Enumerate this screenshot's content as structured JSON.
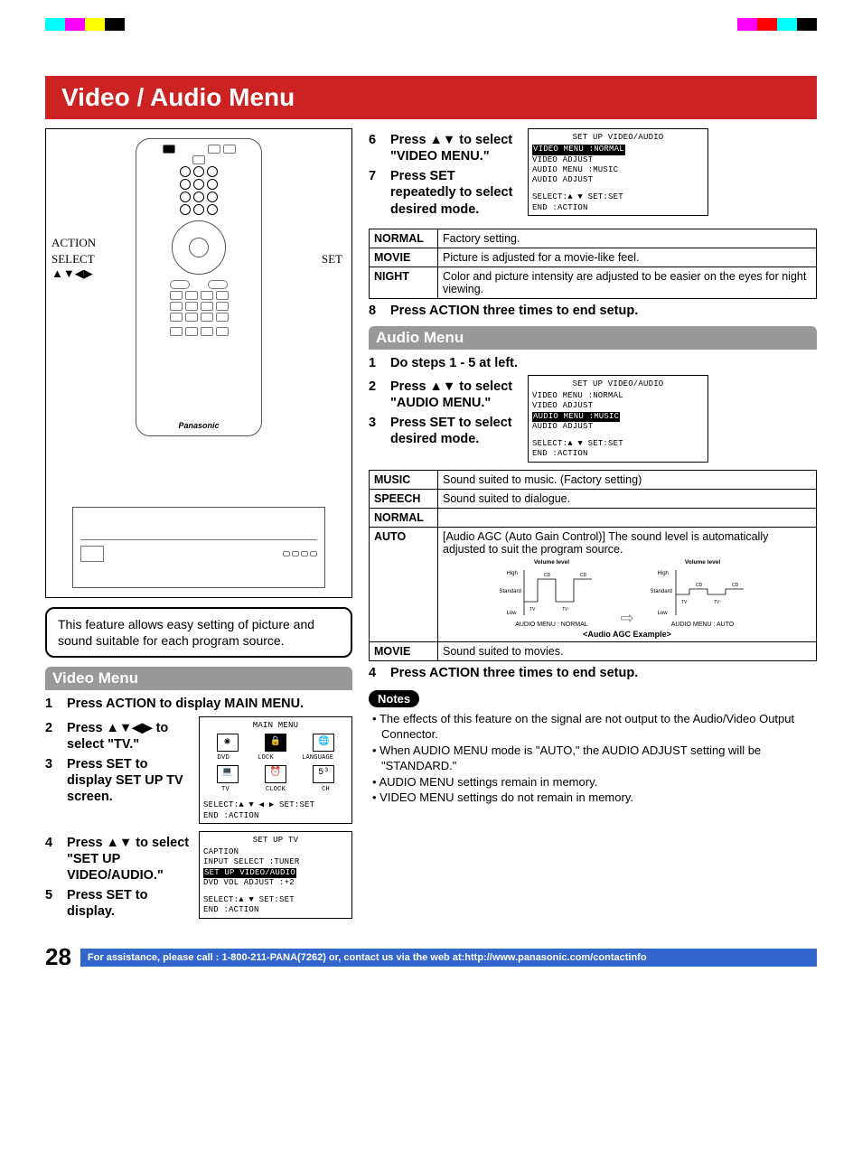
{
  "colorbars": [
    "#0ff",
    "#f0f",
    "#ff0",
    "#000",
    "",
    "#f0f",
    "#f00",
    "#0ff",
    "#000"
  ],
  "title": "Video / Audio Menu",
  "remote": {
    "label_action": "ACTION",
    "label_select": "SELECT",
    "label_arrows": "▲▼◀▶",
    "label_set": "SET",
    "brand": "Panasonic"
  },
  "feature_note": "This feature allows easy setting of picture and sound suitable for each program source.",
  "video_menu": {
    "header": "Video Menu",
    "steps": [
      {
        "n": "1",
        "t": "Press ACTION to display MAIN MENU."
      },
      {
        "n": "2",
        "t": "Press ▲▼◀▶ to select \"TV.\""
      },
      {
        "n": "3",
        "t": "Press SET to display SET UP TV screen."
      },
      {
        "n": "4",
        "t": "Press ▲▼ to select \"SET UP VIDEO/AUDIO.\""
      },
      {
        "n": "5",
        "t": "Press SET to display."
      }
    ],
    "osd_main": {
      "title": "MAIN MENU",
      "row1": [
        "DVD",
        "LOCK",
        "LANGUAGE"
      ],
      "row2": [
        "TV",
        "CLOCK",
        "CH"
      ],
      "foot1": "SELECT:▲ ▼ ◀ ▶  SET:SET",
      "foot2": "END   :ACTION"
    },
    "osd_setuptv": {
      "title": "SET UP TV",
      "lines": [
        "CAPTION",
        "INPUT SELECT   :TUNER"
      ],
      "sel": "SET UP VIDEO/AUDIO",
      "after": "DVD VOL ADJUST :+2",
      "foot1": "SELECT:▲ ▼        SET:SET",
      "foot2": "END   :ACTION"
    }
  },
  "right_top": {
    "steps67": [
      {
        "n": "6",
        "t": "Press ▲▼ to select \"VIDEO MENU.\""
      },
      {
        "n": "7",
        "t": "Press SET repeatedly to select desired mode."
      }
    ],
    "osd": {
      "title": "SET UP VIDEO/AUDIO",
      "sel_line": "VIDEO MENU   :NORMAL",
      "lines": [
        "VIDEO ADJUST",
        "AUDIO MENU   :MUSIC",
        "AUDIO ADJUST"
      ],
      "foot1": "SELECT:▲ ▼        SET:SET",
      "foot2": "END   :ACTION"
    },
    "table": [
      {
        "k": "NORMAL",
        "v": "Factory setting."
      },
      {
        "k": "MOVIE",
        "v": "Picture is adjusted for a movie-like feel."
      },
      {
        "k": "NIGHT",
        "v": "Color and picture intensity are adjusted to be easier on the eyes for night viewing."
      }
    ],
    "step8": {
      "n": "8",
      "t": "Press ACTION three times to end setup."
    }
  },
  "audio_menu": {
    "header": "Audio Menu",
    "steps": [
      {
        "n": "1",
        "t": "Do steps 1 - 5 at left."
      },
      {
        "n": "2",
        "t": "Press ▲▼ to select \"AUDIO MENU.\""
      },
      {
        "n": "3",
        "t": "Press SET to select desired mode."
      }
    ],
    "osd": {
      "title": "SET UP VIDEO/AUDIO",
      "lines_before": [
        "VIDEO MENU   :NORMAL",
        "VIDEO ADJUST"
      ],
      "sel_line": "AUDIO MENU   :MUSIC",
      "lines_after": [
        "AUDIO ADJUST"
      ],
      "foot1": "SELECT:▲ ▼        SET:SET",
      "foot2": "END   :ACTION"
    },
    "table": [
      {
        "k": "MUSIC",
        "v": "Sound suited to music. (Factory setting)"
      },
      {
        "k": "SPEECH",
        "v": "Sound suited to dialogue."
      },
      {
        "k": "NORMAL",
        "v": ""
      },
      {
        "k": "AUTO",
        "v": "[Audio AGC (Auto Gain Control)] The sound level is automatically adjusted to suit the program source."
      },
      {
        "k": "MOVIE",
        "v": "Sound suited to movies."
      }
    ],
    "agc": {
      "vol_label": "Volume level",
      "high": "High",
      "standard": "Standard",
      "low": "Low",
      "tv": "TV",
      "cd": "CD",
      "cap_normal": "AUDIO MENU : NORMAL",
      "cap_auto": "AUDIO MENU : AUTO",
      "example": "<Audio AGC Example>"
    },
    "step4": {
      "n": "4",
      "t": "Press ACTION three times to end setup."
    }
  },
  "notes": {
    "pill": "Notes",
    "items": [
      "The effects of this feature on the signal are not output to the Audio/Video Output Connector.",
      "When AUDIO MENU mode is \"AUTO,\" the AUDIO ADJUST setting will be \"STANDARD.\"",
      "AUDIO MENU settings remain in memory.",
      "VIDEO MENU settings do not remain in memory."
    ]
  },
  "footer": {
    "page": "28",
    "assist": "For assistance, please call : 1-800-211-PANA(7262) or, contact us via the web at:http://www.panasonic.com/contactinfo"
  }
}
